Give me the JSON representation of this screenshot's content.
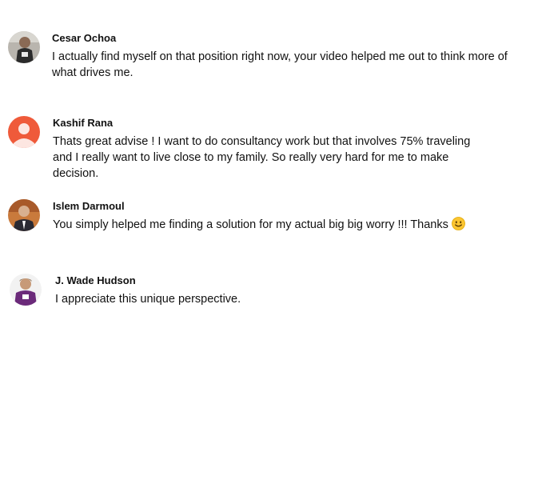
{
  "comments": [
    {
      "author": "Cesar Ochoa",
      "text": "I actually find myself on that position right now, your video helped me out to think more of what drives me.",
      "avatar_icon": "user-photo-avatar"
    },
    {
      "author": "Kashif Rana",
      "text": "Thats great advise ! I want to do consultancy work but that involves 75% traveling and I really want to live close to my family. So really very hard for me to make decision.",
      "avatar_icon": "default-user-avatar",
      "avatar_color": "#ef5a3a"
    },
    {
      "author": "Islem Darmoul",
      "text": "You simply helped me finding a solution for my actual big big worry !!! Thanks",
      "emoji": "smiling-face-emoji",
      "avatar_icon": "user-photo-avatar"
    },
    {
      "author": "J. Wade Hudson",
      "text": "I appreciate this unique perspective.",
      "avatar_icon": "user-photo-avatar"
    }
  ]
}
